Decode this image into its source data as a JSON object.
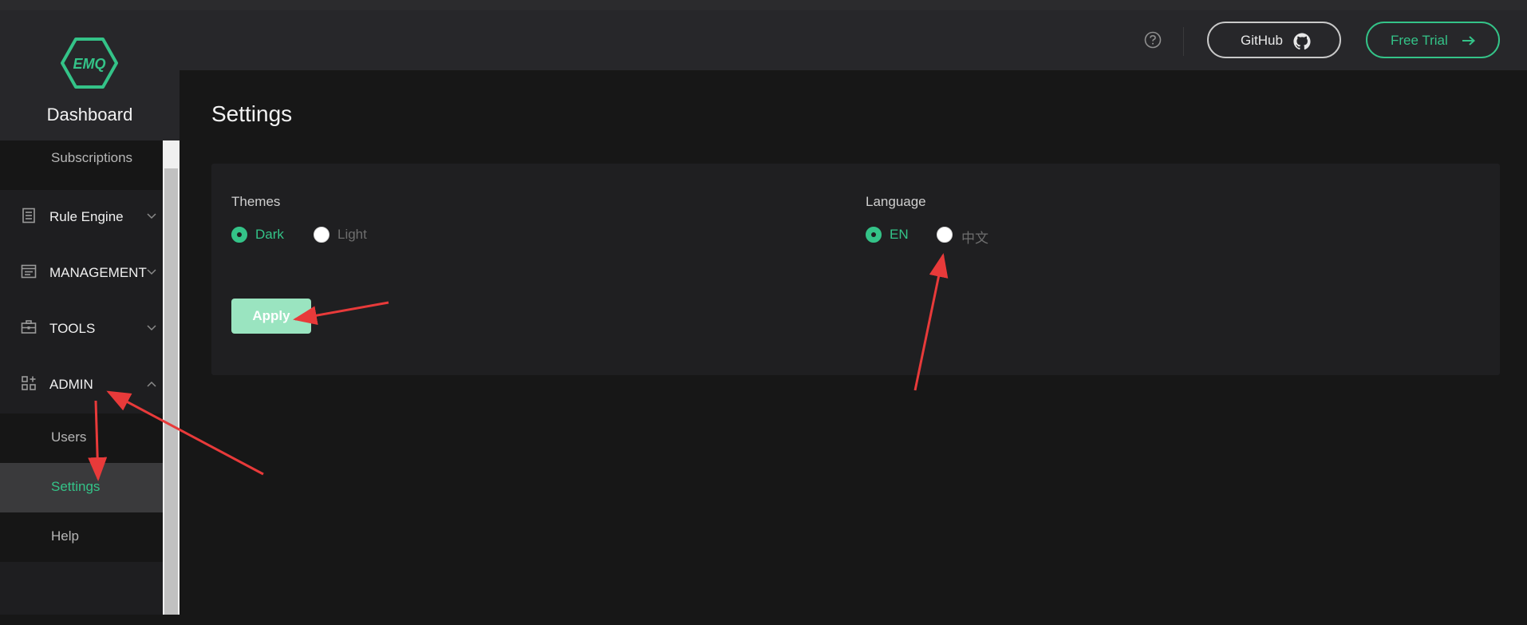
{
  "brand": {
    "logo_text": "EMQ",
    "title": "Dashboard"
  },
  "sidebar": {
    "items": [
      {
        "label": "Subscriptions",
        "type": "sub"
      },
      {
        "label": "Rule Engine",
        "type": "group",
        "icon": "document-icon",
        "expanded": false
      },
      {
        "label": "MANAGEMENT",
        "type": "group",
        "icon": "list-window-icon",
        "expanded": false
      },
      {
        "label": "TOOLS",
        "type": "group",
        "icon": "toolbox-icon",
        "expanded": false
      },
      {
        "label": "ADMIN",
        "type": "group",
        "icon": "grid-apps-icon",
        "expanded": true
      },
      {
        "label": "Users",
        "type": "sub"
      },
      {
        "label": "Settings",
        "type": "sub",
        "active": true
      },
      {
        "label": "Help",
        "type": "sub"
      }
    ]
  },
  "header": {
    "help_icon": "question-circle-icon",
    "github_label": "GitHub",
    "github_icon": "github-icon",
    "trial_label": "Free Trial",
    "trial_icon": "arrow-right-icon"
  },
  "main": {
    "title": "Settings",
    "themes": {
      "label": "Themes",
      "options": [
        {
          "label": "Dark",
          "selected": true
        },
        {
          "label": "Light",
          "selected": false
        }
      ]
    },
    "language": {
      "label": "Language",
      "options": [
        {
          "label": "EN",
          "selected": true
        },
        {
          "label": "中文",
          "selected": false
        }
      ]
    },
    "apply_label": "Apply"
  },
  "colors": {
    "accent": "#34c388",
    "apply_bg": "#9ae4c0",
    "annotation_arrow": "#e83a3a",
    "background": "#171717",
    "panel": "#27272a"
  }
}
